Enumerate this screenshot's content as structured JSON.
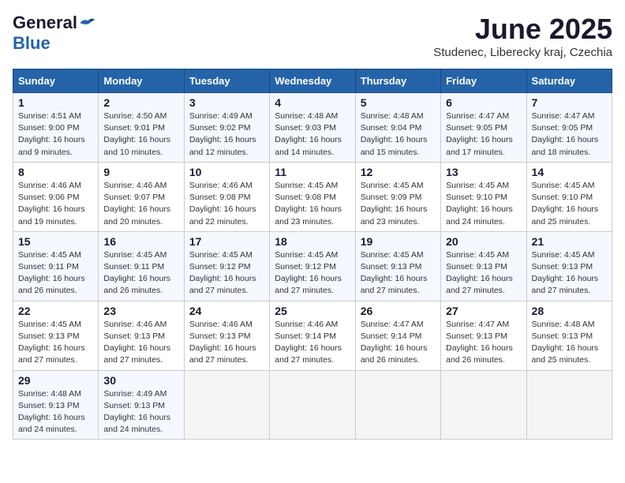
{
  "header": {
    "logo_general": "General",
    "logo_blue": "Blue",
    "title": "June 2025",
    "location": "Studenec, Liberecky kraj, Czechia"
  },
  "weekdays": [
    "Sunday",
    "Monday",
    "Tuesday",
    "Wednesday",
    "Thursday",
    "Friday",
    "Saturday"
  ],
  "weeks": [
    [
      {
        "day": "1",
        "info": "Sunrise: 4:51 AM\nSunset: 9:00 PM\nDaylight: 16 hours\nand 9 minutes."
      },
      {
        "day": "2",
        "info": "Sunrise: 4:50 AM\nSunset: 9:01 PM\nDaylight: 16 hours\nand 10 minutes."
      },
      {
        "day": "3",
        "info": "Sunrise: 4:49 AM\nSunset: 9:02 PM\nDaylight: 16 hours\nand 12 minutes."
      },
      {
        "day": "4",
        "info": "Sunrise: 4:48 AM\nSunset: 9:03 PM\nDaylight: 16 hours\nand 14 minutes."
      },
      {
        "day": "5",
        "info": "Sunrise: 4:48 AM\nSunset: 9:04 PM\nDaylight: 16 hours\nand 15 minutes."
      },
      {
        "day": "6",
        "info": "Sunrise: 4:47 AM\nSunset: 9:05 PM\nDaylight: 16 hours\nand 17 minutes."
      },
      {
        "day": "7",
        "info": "Sunrise: 4:47 AM\nSunset: 9:05 PM\nDaylight: 16 hours\nand 18 minutes."
      }
    ],
    [
      {
        "day": "8",
        "info": "Sunrise: 4:46 AM\nSunset: 9:06 PM\nDaylight: 16 hours\nand 19 minutes."
      },
      {
        "day": "9",
        "info": "Sunrise: 4:46 AM\nSunset: 9:07 PM\nDaylight: 16 hours\nand 20 minutes."
      },
      {
        "day": "10",
        "info": "Sunrise: 4:46 AM\nSunset: 9:08 PM\nDaylight: 16 hours\nand 22 minutes."
      },
      {
        "day": "11",
        "info": "Sunrise: 4:45 AM\nSunset: 9:08 PM\nDaylight: 16 hours\nand 23 minutes."
      },
      {
        "day": "12",
        "info": "Sunrise: 4:45 AM\nSunset: 9:09 PM\nDaylight: 16 hours\nand 23 minutes."
      },
      {
        "day": "13",
        "info": "Sunrise: 4:45 AM\nSunset: 9:10 PM\nDaylight: 16 hours\nand 24 minutes."
      },
      {
        "day": "14",
        "info": "Sunrise: 4:45 AM\nSunset: 9:10 PM\nDaylight: 16 hours\nand 25 minutes."
      }
    ],
    [
      {
        "day": "15",
        "info": "Sunrise: 4:45 AM\nSunset: 9:11 PM\nDaylight: 16 hours\nand 26 minutes."
      },
      {
        "day": "16",
        "info": "Sunrise: 4:45 AM\nSunset: 9:11 PM\nDaylight: 16 hours\nand 26 minutes."
      },
      {
        "day": "17",
        "info": "Sunrise: 4:45 AM\nSunset: 9:12 PM\nDaylight: 16 hours\nand 27 minutes."
      },
      {
        "day": "18",
        "info": "Sunrise: 4:45 AM\nSunset: 9:12 PM\nDaylight: 16 hours\nand 27 minutes."
      },
      {
        "day": "19",
        "info": "Sunrise: 4:45 AM\nSunset: 9:13 PM\nDaylight: 16 hours\nand 27 minutes."
      },
      {
        "day": "20",
        "info": "Sunrise: 4:45 AM\nSunset: 9:13 PM\nDaylight: 16 hours\nand 27 minutes."
      },
      {
        "day": "21",
        "info": "Sunrise: 4:45 AM\nSunset: 9:13 PM\nDaylight: 16 hours\nand 27 minutes."
      }
    ],
    [
      {
        "day": "22",
        "info": "Sunrise: 4:45 AM\nSunset: 9:13 PM\nDaylight: 16 hours\nand 27 minutes."
      },
      {
        "day": "23",
        "info": "Sunrise: 4:46 AM\nSunset: 9:13 PM\nDaylight: 16 hours\nand 27 minutes."
      },
      {
        "day": "24",
        "info": "Sunrise: 4:46 AM\nSunset: 9:13 PM\nDaylight: 16 hours\nand 27 minutes."
      },
      {
        "day": "25",
        "info": "Sunrise: 4:46 AM\nSunset: 9:14 PM\nDaylight: 16 hours\nand 27 minutes."
      },
      {
        "day": "26",
        "info": "Sunrise: 4:47 AM\nSunset: 9:14 PM\nDaylight: 16 hours\nand 26 minutes."
      },
      {
        "day": "27",
        "info": "Sunrise: 4:47 AM\nSunset: 9:13 PM\nDaylight: 16 hours\nand 26 minutes."
      },
      {
        "day": "28",
        "info": "Sunrise: 4:48 AM\nSunset: 9:13 PM\nDaylight: 16 hours\nand 25 minutes."
      }
    ],
    [
      {
        "day": "29",
        "info": "Sunrise: 4:48 AM\nSunset: 9:13 PM\nDaylight: 16 hours\nand 24 minutes."
      },
      {
        "day": "30",
        "info": "Sunrise: 4:49 AM\nSunset: 9:13 PM\nDaylight: 16 hours\nand 24 minutes."
      },
      {
        "day": "",
        "info": ""
      },
      {
        "day": "",
        "info": ""
      },
      {
        "day": "",
        "info": ""
      },
      {
        "day": "",
        "info": ""
      },
      {
        "day": "",
        "info": ""
      }
    ]
  ]
}
